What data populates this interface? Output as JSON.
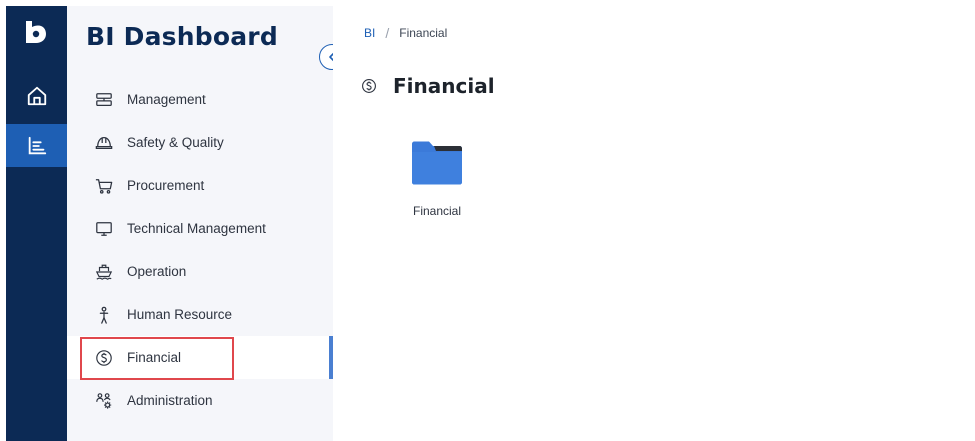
{
  "app": {
    "title": "BI Dashboard"
  },
  "rail": {
    "items": [
      {
        "icon": "home-icon"
      },
      {
        "icon": "analytics-icon",
        "active": true
      }
    ]
  },
  "sidebar": {
    "items": [
      {
        "label": "Management",
        "icon": "management-icon"
      },
      {
        "label": "Safety & Quality",
        "icon": "hard-hat-icon"
      },
      {
        "label": "Procurement",
        "icon": "cart-icon"
      },
      {
        "label": "Technical Management",
        "icon": "monitor-icon"
      },
      {
        "label": "Operation",
        "icon": "ship-icon"
      },
      {
        "label": "Human Resource",
        "icon": "person-icon"
      },
      {
        "label": "Financial",
        "icon": "dollar-coin-icon",
        "active": true
      },
      {
        "label": "Administration",
        "icon": "people-gear-icon"
      }
    ]
  },
  "breadcrumb": {
    "root": "BI",
    "separator": "/",
    "current": "Financial"
  },
  "page": {
    "title": "Financial"
  },
  "folders": [
    {
      "label": "Financial"
    }
  ],
  "colors": {
    "rail": "#0c2a55",
    "accent": "#1e5fb4",
    "folder": "#3b7ad9",
    "highlight": "#e0474c"
  }
}
